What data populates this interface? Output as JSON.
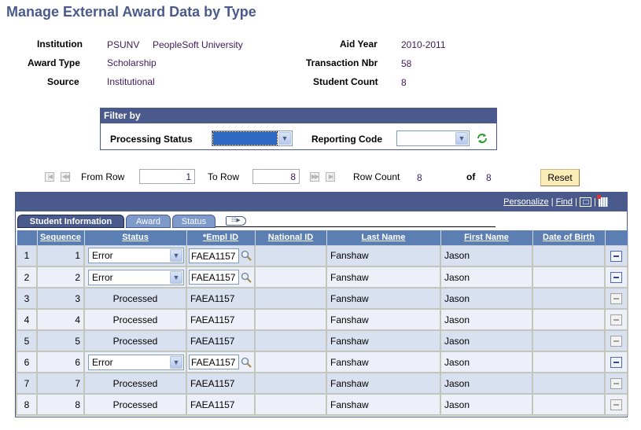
{
  "page": {
    "title": "Manage External Award Data by Type"
  },
  "header": {
    "institution_label": "Institution",
    "institution_code": "PSUNV",
    "institution_name": "PeopleSoft University",
    "award_type_label": "Award Type",
    "award_type": "Scholarship",
    "source_label": "Source",
    "source": "Institutional",
    "aid_year_label": "Aid Year",
    "aid_year": "2010-2011",
    "transaction_label": "Transaction Nbr",
    "transaction": "58",
    "student_count_label": "Student Count",
    "student_count": "8"
  },
  "filter": {
    "title": "Filter by",
    "processing_status_label": "Processing Status",
    "processing_status_value": "",
    "reporting_code_label": "Reporting Code",
    "reporting_code_value": "",
    "refresh_icon": "refresh-icon"
  },
  "nav": {
    "from_row_label": "From Row",
    "from_row": "1",
    "to_row_label": "To Row",
    "to_row": "8",
    "row_count_label": "Row Count",
    "row_count": "8",
    "of_label": "of",
    "of_value": "8",
    "reset_label": "Reset"
  },
  "grid": {
    "personalize": "Personalize",
    "find": "Find",
    "sep": "|",
    "tabs": [
      {
        "label": "Student Information",
        "active": true
      },
      {
        "label": "Award",
        "active": false
      },
      {
        "label": "Status",
        "active": false
      }
    ],
    "columns": [
      "Sequence",
      "Status",
      "*Empl ID",
      "National ID",
      "Last Name",
      "First Name",
      "Date of Birth"
    ],
    "rows": [
      {
        "row": "1",
        "sequence": "1",
        "status": "Error",
        "editable": true,
        "empl_id": "FAEA1157",
        "national_id": "",
        "last_name": "Fanshaw",
        "first_name": "Jason",
        "dob": ""
      },
      {
        "row": "2",
        "sequence": "2",
        "status": "Error",
        "editable": true,
        "empl_id": "FAEA1157",
        "national_id": "",
        "last_name": "Fanshaw",
        "first_name": "Jason",
        "dob": ""
      },
      {
        "row": "3",
        "sequence": "3",
        "status": "Processed",
        "editable": false,
        "empl_id": "FAEA1157",
        "national_id": "",
        "last_name": "Fanshaw",
        "first_name": "Jason",
        "dob": ""
      },
      {
        "row": "4",
        "sequence": "4",
        "status": "Processed",
        "editable": false,
        "empl_id": "FAEA1157",
        "national_id": "",
        "last_name": "Fanshaw",
        "first_name": "Jason",
        "dob": ""
      },
      {
        "row": "5",
        "sequence": "5",
        "status": "Processed",
        "editable": false,
        "empl_id": "FAEA1157",
        "national_id": "",
        "last_name": "Fanshaw",
        "first_name": "Jason",
        "dob": ""
      },
      {
        "row": "6",
        "sequence": "6",
        "status": "Error",
        "editable": true,
        "empl_id": "FAEA1157",
        "national_id": "",
        "last_name": "Fanshaw",
        "first_name": "Jason",
        "dob": ""
      },
      {
        "row": "7",
        "sequence": "7",
        "status": "Processed",
        "editable": false,
        "empl_id": "FAEA1157",
        "national_id": "",
        "last_name": "Fanshaw",
        "first_name": "Jason",
        "dob": ""
      },
      {
        "row": "8",
        "sequence": "8",
        "status": "Processed",
        "editable": false,
        "empl_id": "FAEA1157",
        "national_id": "",
        "last_name": "Fanshaw",
        "first_name": "Jason",
        "dob": ""
      }
    ]
  },
  "colors": {
    "brand": "#4a5a8c",
    "header_cell": "#5c7fb3",
    "row_odd": "#d9e0f0",
    "row_even": "#edf0f8",
    "button": "#fcedb8"
  }
}
